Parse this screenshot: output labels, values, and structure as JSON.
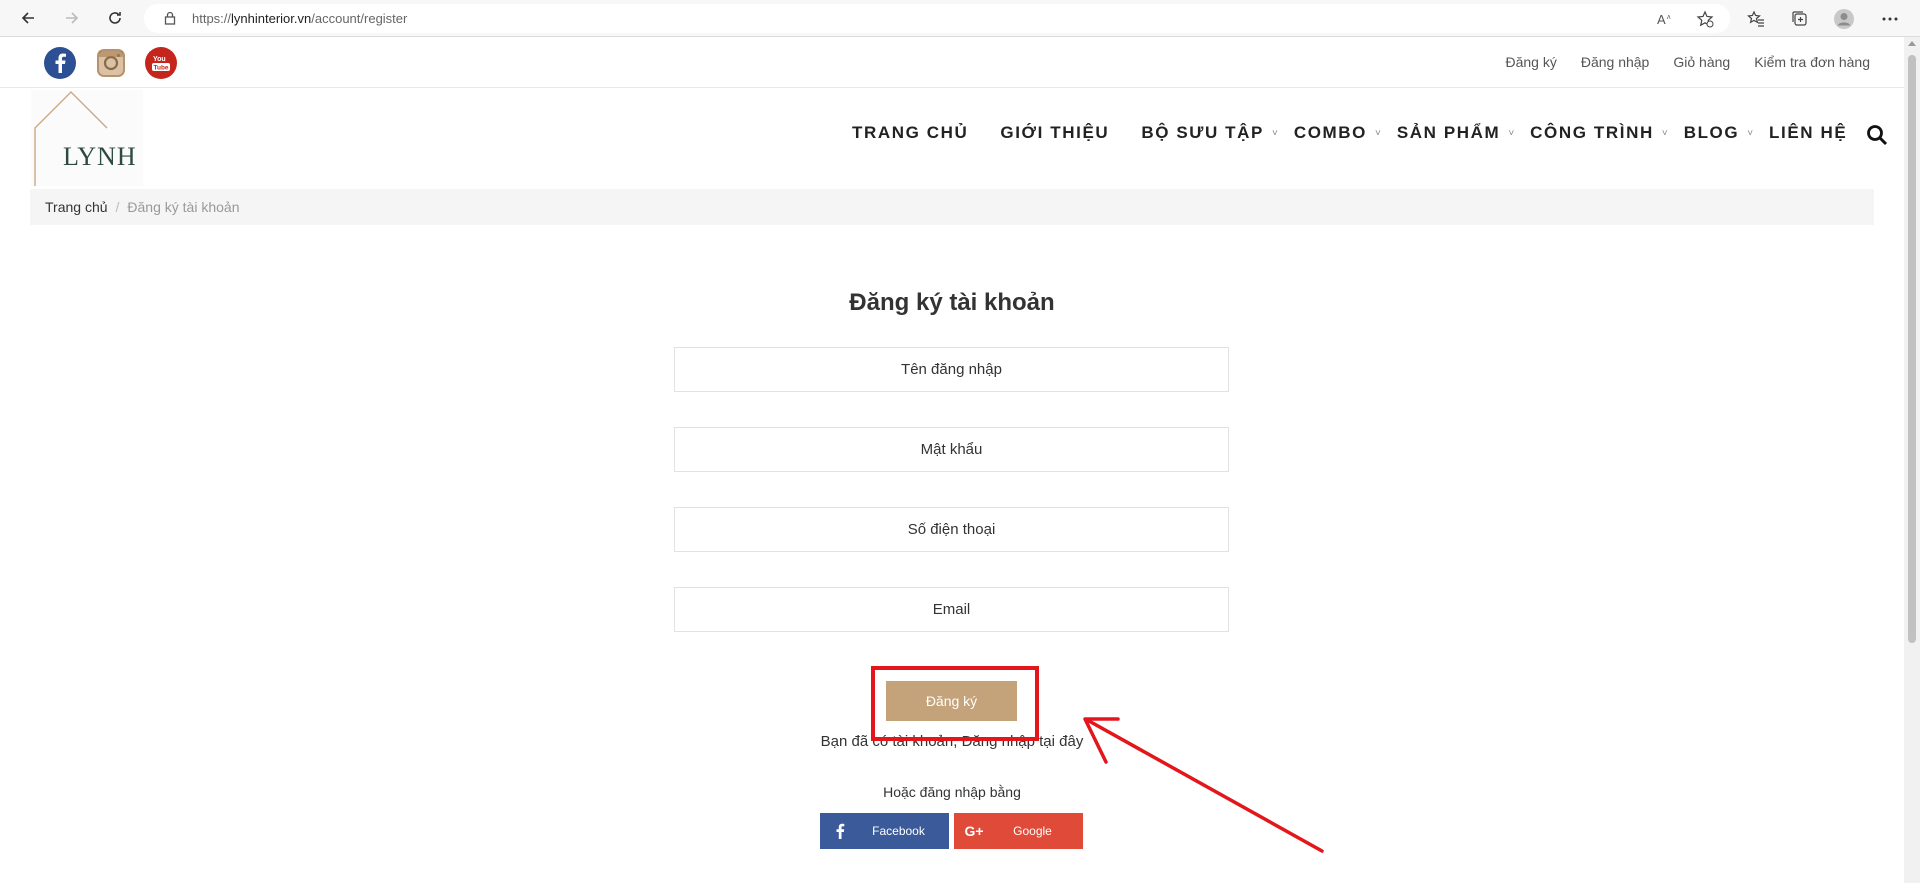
{
  "browser": {
    "url_prefix": "https://",
    "url_domain": "lynhinterior.vn",
    "url_path": "/account/register"
  },
  "topbar": {
    "links": [
      "Đăng ký",
      "Đăng nhập",
      "Giỏ hàng",
      "Kiểm tra đơn hàng"
    ]
  },
  "logo": {
    "text": "LYNH"
  },
  "nav": {
    "items": [
      {
        "label": "TRANG CHỦ"
      },
      {
        "label": "GIỚI THIỆU"
      },
      {
        "label": "BỘ SƯU TẬP"
      },
      {
        "label": "COMBO"
      },
      {
        "label": "SẢN PHẨM"
      },
      {
        "label": "CÔNG TRÌNH"
      },
      {
        "label": "BLOG"
      },
      {
        "label": "LIÊN HỆ"
      }
    ]
  },
  "breadcrumb": {
    "home": "Trang chủ",
    "separator": "/",
    "current": "Đăng ký tài khoản"
  },
  "form": {
    "title": "Đăng ký tài khoản",
    "username_placeholder": "Tên đăng nhập",
    "password_placeholder": "Mật khẩu",
    "phone_placeholder": "Số điện thoại",
    "email_placeholder": "Email",
    "submit_label": "Đăng ký",
    "login_prompt": "Bạn đã có tài khoản, Đăng nhập tại đây",
    "or_label": "Hoặc đăng nhập bằng",
    "facebook_label": "Facebook",
    "google_label": "Google",
    "google_icon_text": "G+"
  },
  "colors": {
    "accent": "#c4a27a",
    "facebook": "#3b5a99",
    "google": "#e04a39",
    "annotation": "#e3161c"
  }
}
